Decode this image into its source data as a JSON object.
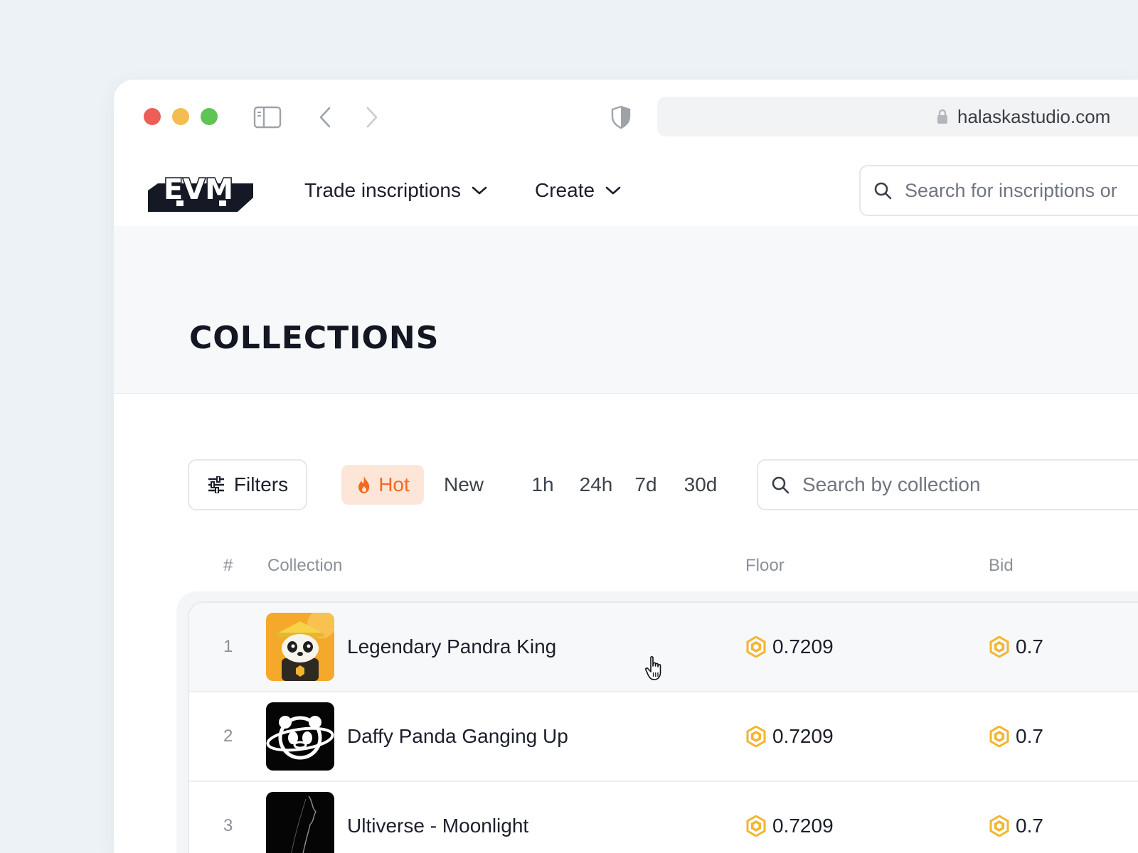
{
  "browser": {
    "url": "halaskastudio.com",
    "icons": [
      "sidebar-icon",
      "back-arrow-icon",
      "forward-arrow-icon",
      "shield-icon",
      "lock-icon"
    ]
  },
  "header": {
    "logo_text": "EVM",
    "nav": [
      {
        "label": "Trade inscriptions"
      },
      {
        "label": "Create"
      }
    ],
    "search_placeholder": "Search for inscriptions or"
  },
  "page": {
    "title": "COLLECTIONS"
  },
  "toolbar": {
    "filters_label": "Filters",
    "sort_hot": "Hot",
    "sort_new": "New",
    "timeframes": [
      "1h",
      "24h",
      "7d",
      "30d"
    ],
    "search_placeholder": "Search by collection",
    "colors": {
      "hot_bg": "#fde6d8",
      "hot_text": "#f36a1c"
    }
  },
  "table": {
    "columns": {
      "num": "#",
      "collection": "Collection",
      "floor": "Floor",
      "bid": "Bid"
    },
    "coin_color": "#f3b52e",
    "rows": [
      {
        "rank": "1",
        "name": "Legendary Pandra King",
        "floor": "0.7209",
        "bid": "0.7"
      },
      {
        "rank": "2",
        "name": "Daffy Panda Ganging Up",
        "floor": "0.7209",
        "bid": "0.7"
      },
      {
        "rank": "3",
        "name": "Ultiverse - Moonlight",
        "floor": "0.7209",
        "bid": "0.7"
      }
    ]
  }
}
